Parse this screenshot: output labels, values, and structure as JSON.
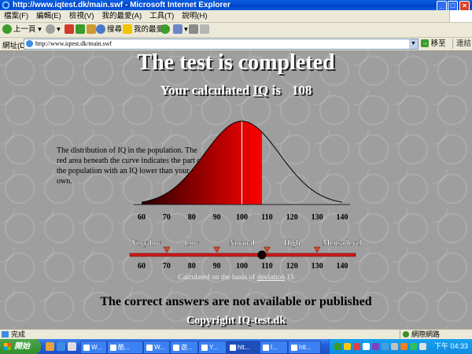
{
  "window": {
    "title": "http://www.iqtest.dk/main.swf - Microsoft Internet Explorer"
  },
  "menu": [
    "檔案(F)",
    "編輯(E)",
    "檢視(V)",
    "我的最愛(A)",
    "工具(T)",
    "說明(H)"
  ],
  "toolbar": {
    "back": "上一頁",
    "search": "搜尋",
    "favorites": "我的最愛"
  },
  "address": {
    "label": "網址(D)",
    "url": "http://www.iqtest.dk/main.swf",
    "go": "移至",
    "links": "連結"
  },
  "page": {
    "title": "The test is completed",
    "iq_prefix": "Your calculated",
    "iq_word": "IQ",
    "iq_suffix": "is",
    "iq_value": "108",
    "description": "The distribution of IQ in the population. The red area beneath the curve indicates the part of the population with an IQ lower than your own.",
    "basis_prefix": "Calculated on the basis of",
    "basis_link": "deviation",
    "basis_value": "15",
    "answers_note": "The correct answers are not available or published",
    "copyright": "Copyright IQ-test.dk"
  },
  "chart_data": {
    "type": "area",
    "distribution": "normal",
    "mean": 100,
    "sd": 15,
    "highlight_below": 108,
    "xlim": [
      60,
      140
    ],
    "ticks": [
      60,
      70,
      80,
      90,
      100,
      110,
      120,
      130,
      140
    ],
    "scale_ticks": [
      60,
      70,
      80,
      90,
      100,
      110,
      120,
      130,
      140
    ],
    "markers": [
      70,
      90,
      110,
      130
    ],
    "user_value": 108,
    "ranges": [
      {
        "label": "Very low",
        "center": 62
      },
      {
        "label": "Low",
        "center": 80
      },
      {
        "label": "Normal",
        "center": 100
      },
      {
        "label": "High",
        "center": 120
      },
      {
        "label": "Mensa level",
        "center": 140
      }
    ],
    "colors": {
      "fill_dark": "#2a0000",
      "fill_light": "#ff0000",
      "scale": "#cc1a1a"
    }
  },
  "status": {
    "text": "完成",
    "zone": "網際網路"
  },
  "taskbar": {
    "start": "開始",
    "tasks": [
      "W...",
      "酷...",
      "W...",
      "遊...",
      "Y...",
      "htt...",
      "I...",
      "htt..."
    ],
    "clock": "下午 04:33"
  }
}
